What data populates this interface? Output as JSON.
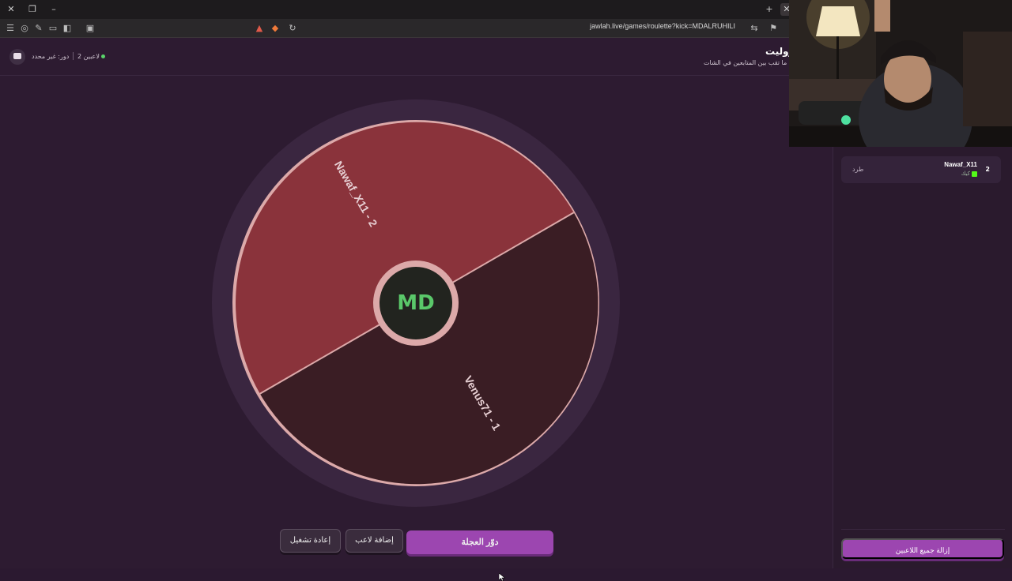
{
  "browser": {
    "url": "jawlah.live/games/roulette?kick=MDALRUHILI"
  },
  "header": {
    "title": "روليت",
    "subtitle": "ما تقب بين المتابعين في الشات",
    "turn_label": "دور: غير محدد",
    "players_count": "2 لاعبين"
  },
  "wheel": {
    "center_logo": "MD",
    "segments": [
      {
        "label": "Nawaf_X11 - 2",
        "color": "#8a333b"
      },
      {
        "label": "Venus71 - 1",
        "color": "#3a1d24"
      }
    ]
  },
  "controls": {
    "spin_label": "دوّر العجلة",
    "add_player_label": "إضافة لاعب",
    "reset_label": "إعادة تشغيل"
  },
  "sidebar": {
    "players": [
      {
        "index": "2",
        "name": "Nawaf_X11",
        "platform": "كيك",
        "kick_label": "طرد"
      }
    ],
    "remove_all_label": "إزالة جميع اللاعبين"
  },
  "colors": {
    "accent": "#9c46b0",
    "background": "#2d1b31",
    "online": "#59d36a"
  }
}
